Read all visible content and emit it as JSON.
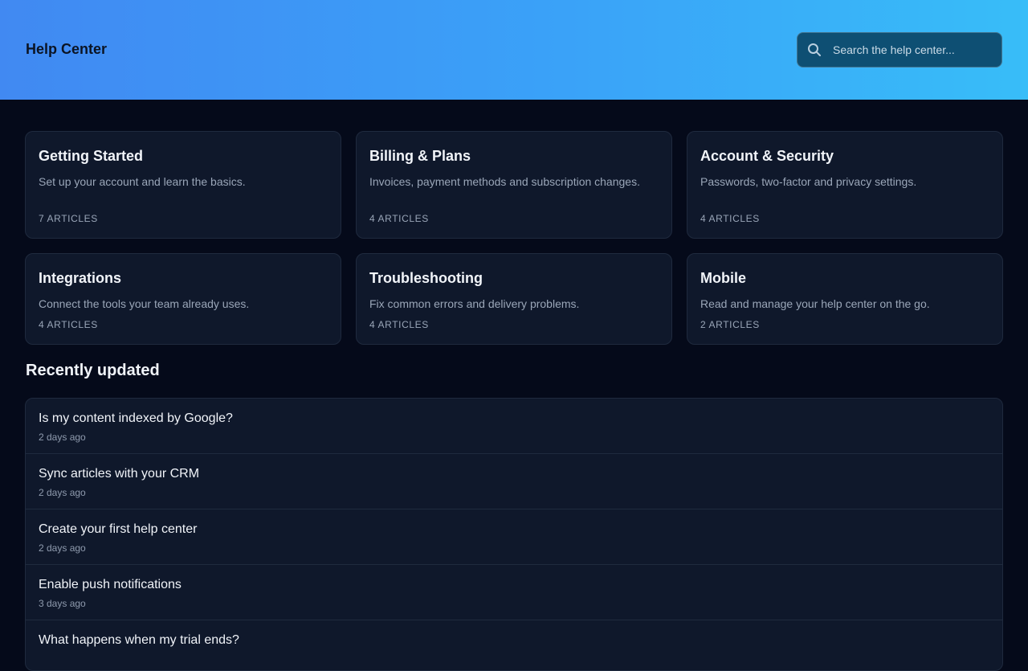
{
  "header": {
    "title": "Help Center",
    "search": {
      "placeholder": "Search the help center...",
      "icon": "search-icon"
    }
  },
  "categories": [
    {
      "title": "Getting Started",
      "description": "Set up your account and learn the basics.",
      "count": "7 ARTICLES"
    },
    {
      "title": "Billing & Plans",
      "description": "Invoices, payment methods and subscription changes.",
      "count": "4 ARTICLES"
    },
    {
      "title": "Account & Security",
      "description": "Passwords, two-factor and privacy settings.",
      "count": "4 ARTICLES"
    },
    {
      "title": "Integrations",
      "description": "Connect the tools your team already uses.",
      "count": "4 ARTICLES"
    },
    {
      "title": "Troubleshooting",
      "description": "Fix common errors and delivery problems.",
      "count": "4 ARTICLES"
    },
    {
      "title": "Mobile",
      "description": "Read and manage your help center on the go.",
      "count": "2 ARTICLES"
    }
  ],
  "recent": {
    "title": "Recently updated",
    "items": [
      {
        "title": "Is my content indexed by Google?",
        "time": "2 days ago"
      },
      {
        "title": "Sync articles with your CRM",
        "time": "2 days ago"
      },
      {
        "title": "Create your first help center",
        "time": "2 days ago"
      },
      {
        "title": "Enable push notifications",
        "time": "3 days ago"
      },
      {
        "title": "What happens when my trial ends?",
        "time": ""
      }
    ]
  },
  "colors": {
    "header_gradient_start": "#4189f2",
    "header_gradient_end": "#38bdf8",
    "background": "#050a1a",
    "card": "#0f182b"
  }
}
